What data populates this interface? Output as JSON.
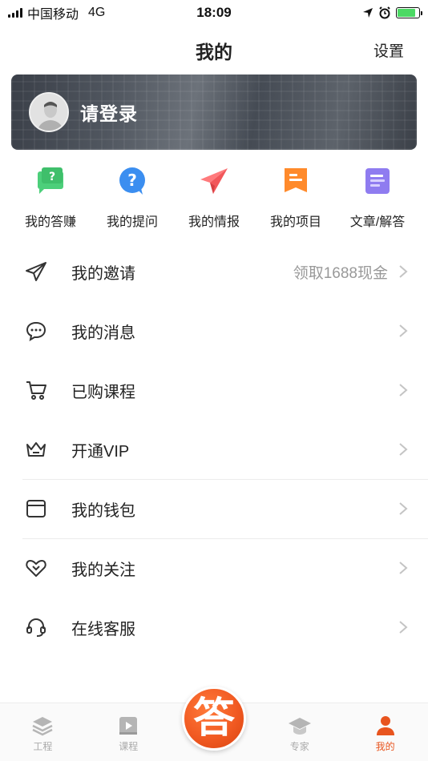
{
  "status_bar": {
    "carrier": "中国移动",
    "network": "4G",
    "time": "18:09",
    "battery_level": 0.85
  },
  "header": {
    "title": "我的",
    "settings_label": "设置"
  },
  "login": {
    "label": "请登录"
  },
  "quick_actions": [
    {
      "label": "我的答赚",
      "icon": "question-chat-icon",
      "color": "#3fbf6b"
    },
    {
      "label": "我的提问",
      "icon": "question-bubble-icon",
      "color": "#3b8ef0"
    },
    {
      "label": "我的情报",
      "icon": "paper-plane-icon",
      "color": "#f2575a"
    },
    {
      "label": "我的项目",
      "icon": "bookmark-doc-icon",
      "color": "#ff8a2b"
    },
    {
      "label": "文章/解答",
      "icon": "article-icon",
      "color": "#8f7cf0"
    }
  ],
  "menu": {
    "items": [
      {
        "label": "我的邀请",
        "extra": "领取1688现金",
        "icon": "paper-plane-outline-icon"
      },
      {
        "label": "我的消息",
        "extra": "",
        "icon": "chat-bubble-icon"
      },
      {
        "label": "已购课程",
        "extra": "",
        "icon": "shopping-cart-icon"
      },
      {
        "label": "开通VIP",
        "extra": "",
        "icon": "crown-icon"
      },
      {
        "label": "我的钱包",
        "extra": "",
        "icon": "wallet-icon"
      },
      {
        "label": "我的关注",
        "extra": "",
        "icon": "heart-icon"
      },
      {
        "label": "在线客服",
        "extra": "",
        "icon": "headset-icon"
      }
    ]
  },
  "tab_bar": {
    "tabs": [
      {
        "label": "工程",
        "icon": "layers-icon",
        "active": false
      },
      {
        "label": "课程",
        "icon": "video-icon",
        "active": false
      },
      {
        "label": "专家",
        "icon": "graduation-cap-icon",
        "active": false
      },
      {
        "label": "我的",
        "icon": "user-icon",
        "active": true
      }
    ],
    "center_button_label": "答"
  },
  "colors": {
    "accent": "#e8541e",
    "muted": "#999999"
  }
}
